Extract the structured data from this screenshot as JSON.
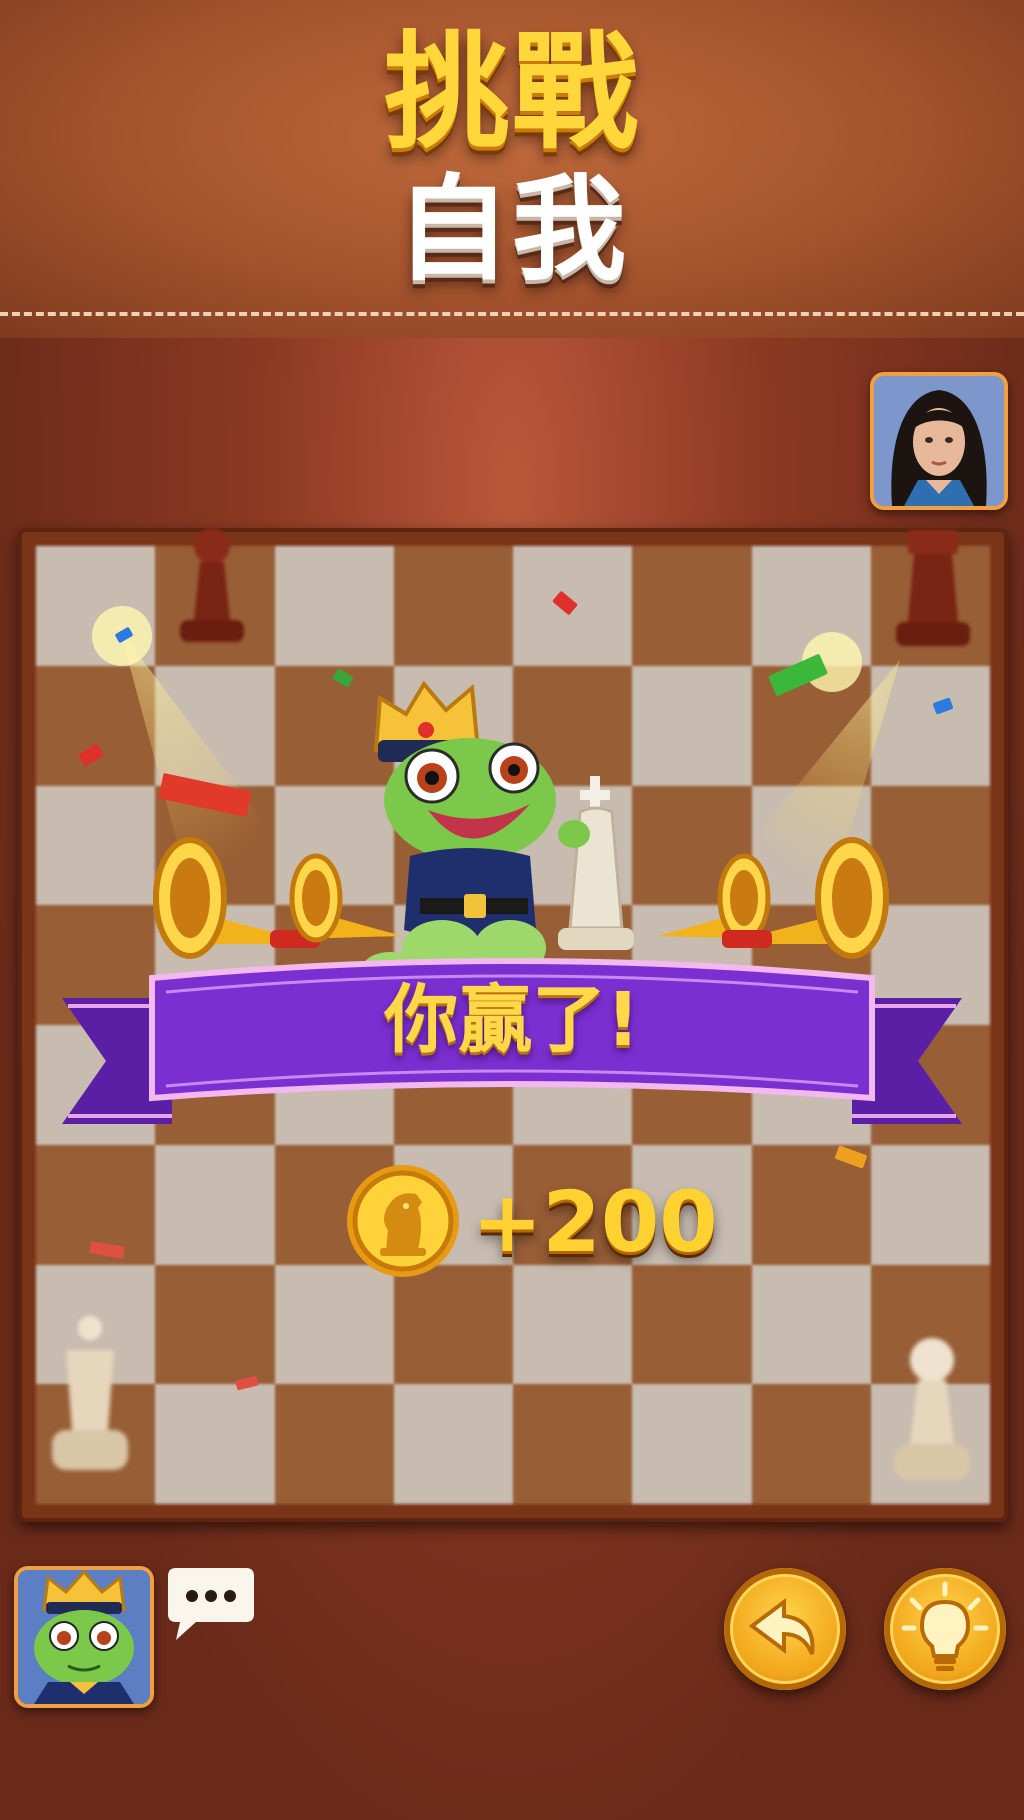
{
  "header": {
    "title_line1": "挑戰",
    "title_line2": "自我"
  },
  "result": {
    "banner_text": "你贏了!",
    "reward_text": "+200",
    "reward_currency_icon": "knight-coin-icon"
  },
  "board": {
    "light_color": "#ded4c8",
    "dark_color": "#a8693d"
  },
  "players": {
    "opponent_avatar": "woman-portrait-avatar",
    "player_avatar": "frog-king-avatar"
  },
  "controls": {
    "chat_icon": "chat-bubble-icon",
    "undo_icon": "undo-arrow-icon",
    "hint_icon": "lightbulb-icon"
  },
  "colors": {
    "title_gold": "#ffd73a",
    "banner_purple": "#7b2fd1",
    "button_gold": "#f2a71c"
  }
}
